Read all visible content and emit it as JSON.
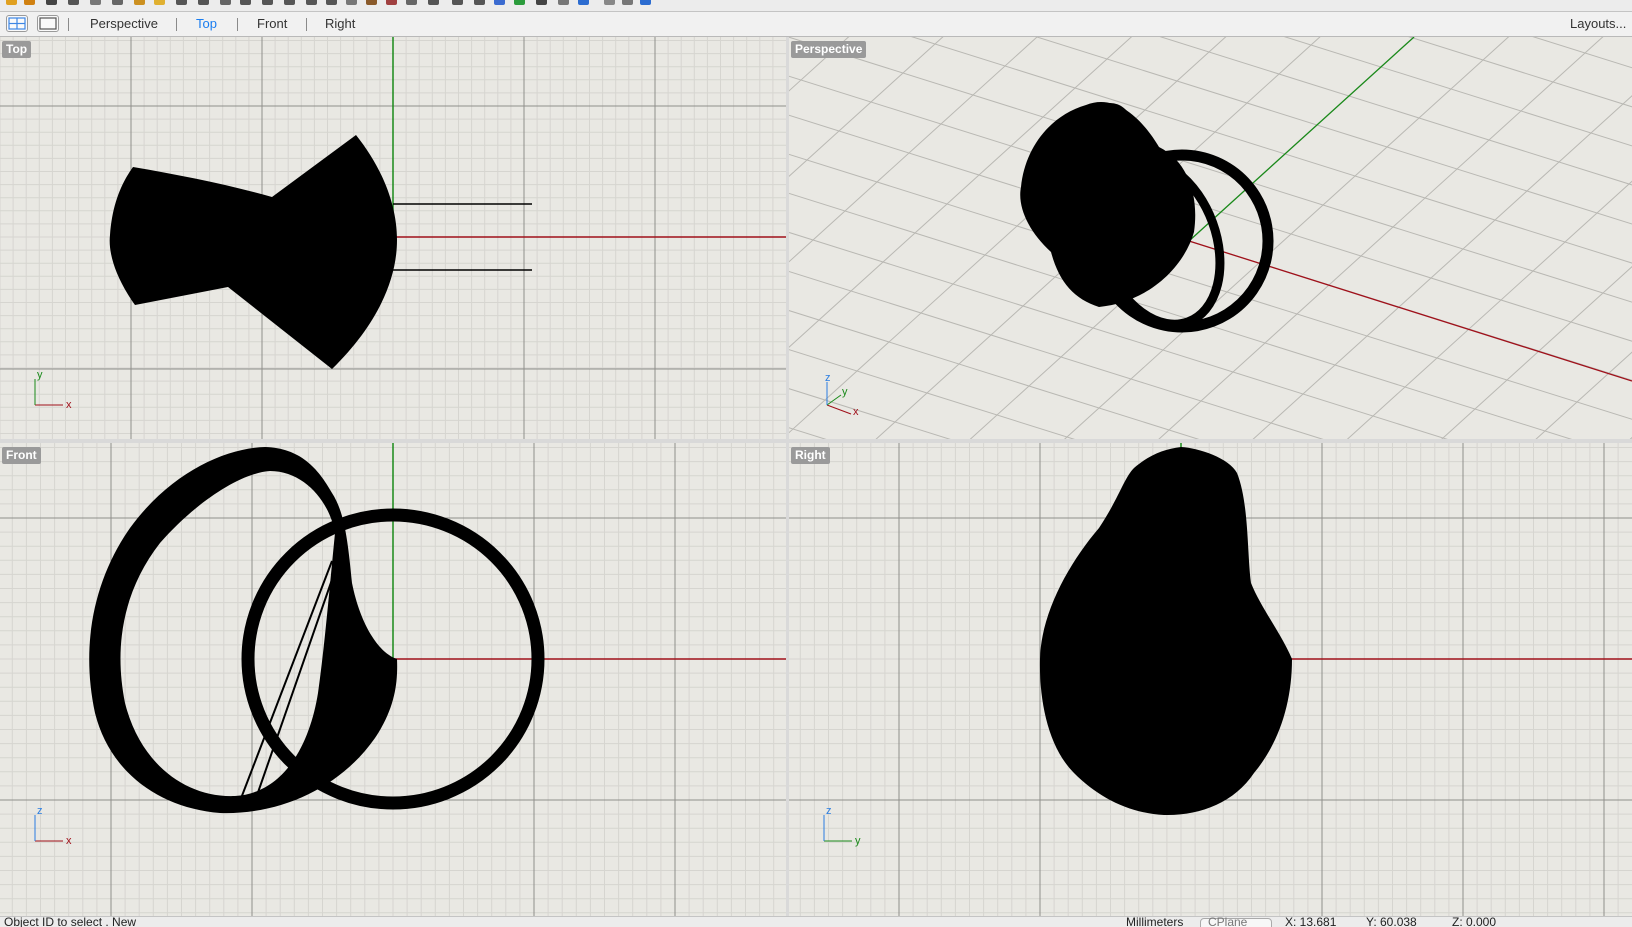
{
  "tabs": [
    {
      "label": "Perspective",
      "active": false
    },
    {
      "label": "Top",
      "active": true
    },
    {
      "label": "Front",
      "active": false
    },
    {
      "label": "Right",
      "active": false
    }
  ],
  "layouts_label": "Layouts...",
  "viewports": {
    "top": {
      "label": "Top",
      "axis_h": "x",
      "axis_v": "y"
    },
    "perspective": {
      "label": "Perspective",
      "axis_x": "x",
      "axis_y": "y",
      "axis_z": "z"
    },
    "front": {
      "label": "Front",
      "axis_h": "x",
      "axis_v": "z"
    },
    "right": {
      "label": "Right",
      "axis_h": "y",
      "axis_v": "z"
    }
  },
  "status": {
    "prompt": "Object ID to select . New",
    "units": "Millimeters",
    "cplane": "CPlane",
    "x": "X: 13.681",
    "y": "Y: 60.038",
    "z": "Z: 0.000"
  },
  "colors": {
    "accent": "#1a7df0",
    "x_axis": "#a0101a",
    "y_axis": "#1a8a1a",
    "z_axis": "#2a7de1",
    "viewport_bg": "#e9e8e3",
    "label_bg": "#9a9a9a"
  }
}
